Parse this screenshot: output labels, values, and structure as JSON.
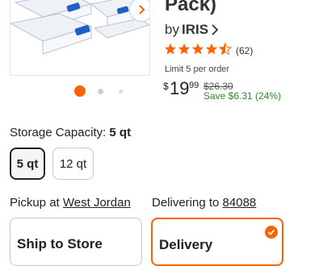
{
  "product": {
    "title_fragment": "Pack)",
    "brand_prefix": "by",
    "brand_name": "IRIS",
    "rating_value": 4.5,
    "rating_count": "(62)",
    "limit_text": "Limit 5 per order",
    "price": {
      "currency": "$",
      "dollars": "19",
      "cents": "99"
    },
    "old_price": "$26.30",
    "savings": "Save $6.31 (24%)"
  },
  "gallery": {
    "total_images": 3,
    "active_index": 0
  },
  "storage": {
    "label": "Storage Capacity:",
    "selected_value": "5 qt",
    "options": [
      "5 qt",
      "12 qt"
    ]
  },
  "fulfillment": {
    "pickup_prefix": "Pickup at",
    "pickup_store": "West Jordan",
    "delivery_prefix": "Delivering to",
    "delivery_zip": "84088",
    "pickup_card_text": "Ship to Store",
    "delivery_card_text": "Delivery"
  },
  "colors": {
    "accent": "#f96302",
    "savings": "#2d8a2d",
    "lid_blue": "#1f5fc6"
  },
  "icons": {
    "next_arrow": "chevron-right-icon",
    "brand_chevron": "chevron-right-icon",
    "star": "star-icon",
    "check": "check-icon"
  }
}
